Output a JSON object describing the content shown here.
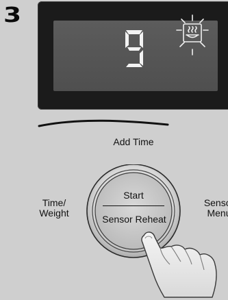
{
  "step": {
    "number": "3"
  },
  "display": {
    "digit": "9",
    "indicator_icon": "sensor-steam-icon"
  },
  "labels": {
    "add_time": "Add Time",
    "time_weight_line1": "Time/",
    "time_weight_line2": "Weight",
    "sensor_menu_line1": "Sensor",
    "sensor_menu_line2": "Menu"
  },
  "button": {
    "start": "Start",
    "sensor_reheat": "Sensor Reheat"
  },
  "colors": {
    "background": "#cfcfcf",
    "display_frame": "#1b1b1b",
    "display_screen": "#555555",
    "digit": "#f2f2f2"
  }
}
